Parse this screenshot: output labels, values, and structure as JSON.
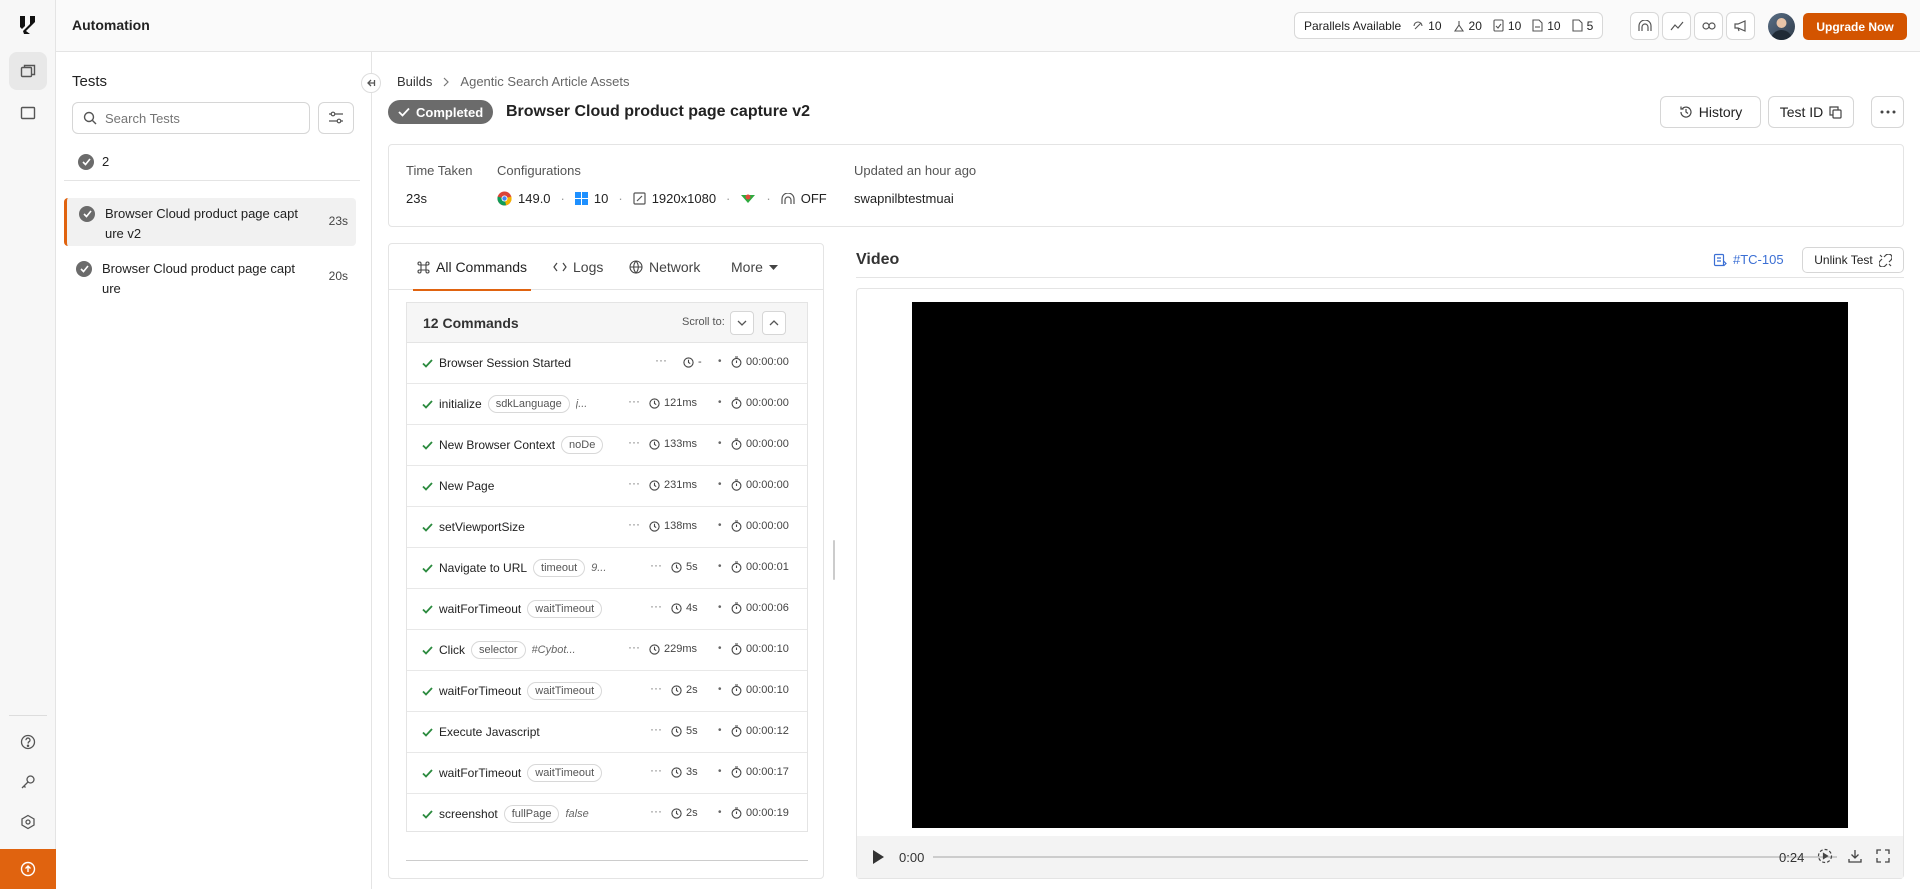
{
  "app": {
    "title": "Automation"
  },
  "topbar": {
    "parallels_label": "Parallels Available",
    "parallels": [
      {
        "icon": "parallel-icon",
        "value": "10"
      },
      {
        "icon": "queue-icon",
        "value": "20"
      },
      {
        "icon": "check-doc-icon",
        "value": "10"
      },
      {
        "icon": "doc-icon",
        "value": "10"
      },
      {
        "icon": "mobile-doc-icon",
        "value": "5"
      }
    ],
    "upgrade_label": "Upgrade Now",
    "accent": "#d35400"
  },
  "tests_panel": {
    "title": "Tests",
    "search_placeholder": "Search Tests",
    "passed_count": "2",
    "items": [
      {
        "name": "Browser Cloud product page capture v2",
        "time": "23s",
        "active": true
      },
      {
        "name": "Browser Cloud product page capture",
        "time": "20s",
        "active": false
      }
    ]
  },
  "breadcrumb": {
    "root": "Builds",
    "build": "Agentic Search Article Assets"
  },
  "test": {
    "status": "Completed",
    "title": "Browser Cloud product page capture v2",
    "history_label": "History",
    "test_id_label": "Test ID"
  },
  "summary": {
    "time_taken_label": "Time Taken",
    "time_taken": "23s",
    "configurations_label": "Configurations",
    "browser_version": "149.0",
    "os_version": "10",
    "resolution": "1920x1080",
    "tunnel": "OFF",
    "updated_label": "Updated an hour ago",
    "user": "swapnilbtestmuai"
  },
  "tabs": {
    "all_commands": "All Commands",
    "logs": "Logs",
    "network": "Network",
    "more": "More"
  },
  "commands": {
    "count_label": "12 Commands",
    "scroll_to": "Scroll to:",
    "rows": [
      {
        "name": "Browser Session Started",
        "param": "",
        "value": "",
        "duration": "-",
        "timestamp": "00:00:00"
      },
      {
        "name": "initialize",
        "param": "sdkLanguage",
        "value": "j...",
        "duration": "121ms",
        "timestamp": "00:00:00"
      },
      {
        "name": "New Browser Context",
        "param": "noDe",
        "value": "",
        "duration": "133ms",
        "timestamp": "00:00:00"
      },
      {
        "name": "New Page",
        "param": "",
        "value": "",
        "duration": "231ms",
        "timestamp": "00:00:00"
      },
      {
        "name": "setViewportSize",
        "param": "",
        "value": "",
        "duration": "138ms",
        "timestamp": "00:00:00"
      },
      {
        "name": "Navigate to URL",
        "param": "timeout",
        "value": "9...",
        "duration": "5s",
        "timestamp": "00:00:01"
      },
      {
        "name": "waitForTimeout",
        "param": "waitTimeout",
        "value": "",
        "duration": "4s",
        "timestamp": "00:00:06"
      },
      {
        "name": "Click",
        "param": "selector",
        "value": "#Cybot...",
        "duration": "229ms",
        "timestamp": "00:00:10"
      },
      {
        "name": "waitForTimeout",
        "param": "waitTimeout",
        "value": "",
        "duration": "2s",
        "timestamp": "00:00:10"
      },
      {
        "name": "Execute Javascript",
        "param": "",
        "value": "",
        "duration": "5s",
        "timestamp": "00:00:12"
      },
      {
        "name": "waitForTimeout",
        "param": "waitTimeout",
        "value": "",
        "duration": "3s",
        "timestamp": "00:00:17"
      },
      {
        "name": "screenshot",
        "param": "fullPage",
        "value": "false",
        "duration": "2s",
        "timestamp": "00:00:19"
      }
    ]
  },
  "video": {
    "title": "Video",
    "tc_link": "#TC-105",
    "unlink_label": "Unlink Test",
    "current_time": "0:00",
    "total_time": "0:24"
  }
}
